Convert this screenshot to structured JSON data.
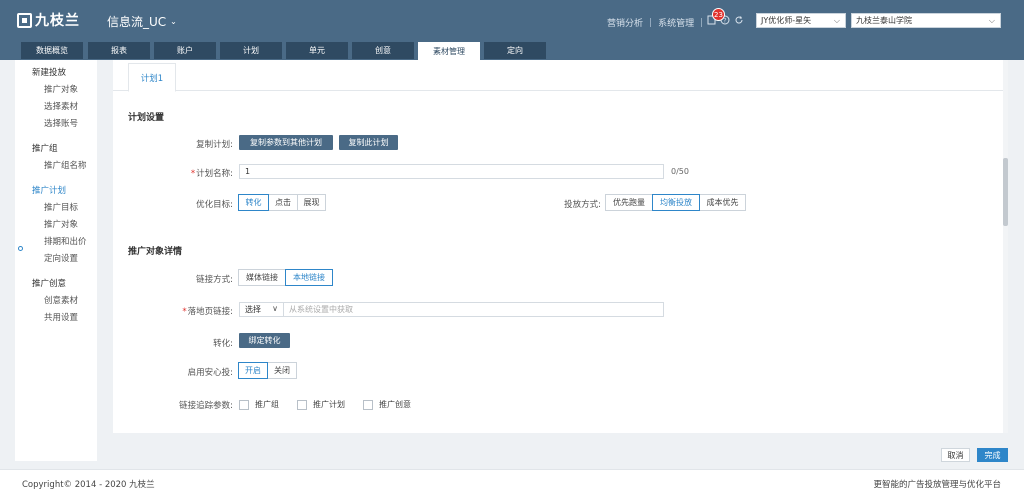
{
  "header": {
    "logo_text": "九枝兰",
    "app_title": "信息流_UC",
    "links": [
      "营销分析",
      "系统管理"
    ],
    "notification_count": "23",
    "account_select": "JY优化师-星矢",
    "org_select": "九枝兰泰山学院"
  },
  "nav": {
    "tabs": [
      "数据概览",
      "报表",
      "账户",
      "计划",
      "单元",
      "创意",
      "素材管理",
      "定向"
    ],
    "active": "素材管理"
  },
  "sidebar": {
    "items": [
      {
        "label": "新建投放",
        "type": "group"
      },
      {
        "label": "推广对象",
        "type": "child"
      },
      {
        "label": "选择素材",
        "type": "child"
      },
      {
        "label": "选择账号",
        "type": "child"
      },
      {
        "label": "推广组",
        "type": "group"
      },
      {
        "label": "推广组名称",
        "type": "child"
      },
      {
        "label": "推广计划",
        "type": "group",
        "current": true
      },
      {
        "label": "推广目标",
        "type": "child"
      },
      {
        "label": "推广对象",
        "type": "child"
      },
      {
        "label": "排期和出价",
        "type": "child"
      },
      {
        "label": "定向设置",
        "type": "child"
      },
      {
        "label": "推广创意",
        "type": "group"
      },
      {
        "label": "创意素材",
        "type": "child"
      },
      {
        "label": "共用设置",
        "type": "child"
      }
    ]
  },
  "content": {
    "plan_tab": "计划1",
    "plan_settings": {
      "title": "计划设置",
      "copy_label": "复制计划:",
      "copy_to_other_btn": "复制参数到其他计划",
      "copy_this_btn": "复制此计划",
      "name_label": "计划名称:",
      "name_value": "1",
      "name_counter": "0/50",
      "goal_label": "优化目标:",
      "goal_options": [
        "转化",
        "点击",
        "展现"
      ],
      "goal_selected": "转化",
      "delivery_label": "投放方式:",
      "delivery_options": [
        "优先跑量",
        "均衡投放",
        "成本优先"
      ],
      "delivery_selected": "均衡投放"
    },
    "target_details": {
      "title": "推广对象详情",
      "link_mode_label": "链接方式:",
      "link_mode_options": [
        "媒体链接",
        "本地链接"
      ],
      "link_mode_selected": "本地链接",
      "landing_label": "落地页链接:",
      "landing_select": "选择",
      "landing_placeholder": "从系统设置中获取",
      "convert_label": "转化:",
      "convert_btn": "绑定转化",
      "safe_label": "启用安心投:",
      "safe_options": [
        "开启",
        "关闭"
      ],
      "safe_selected": "开启",
      "tracking_label": "链接追踪参数:",
      "tracking_options": [
        "推广组",
        "推广计划",
        "推广创意"
      ]
    }
  },
  "actions": {
    "cancel": "取消",
    "done": "完成"
  },
  "footer": {
    "copyright": "Copyright© 2014 - 2020 九枝兰",
    "slogan": "更智能的广告投放管理与优化平台"
  }
}
